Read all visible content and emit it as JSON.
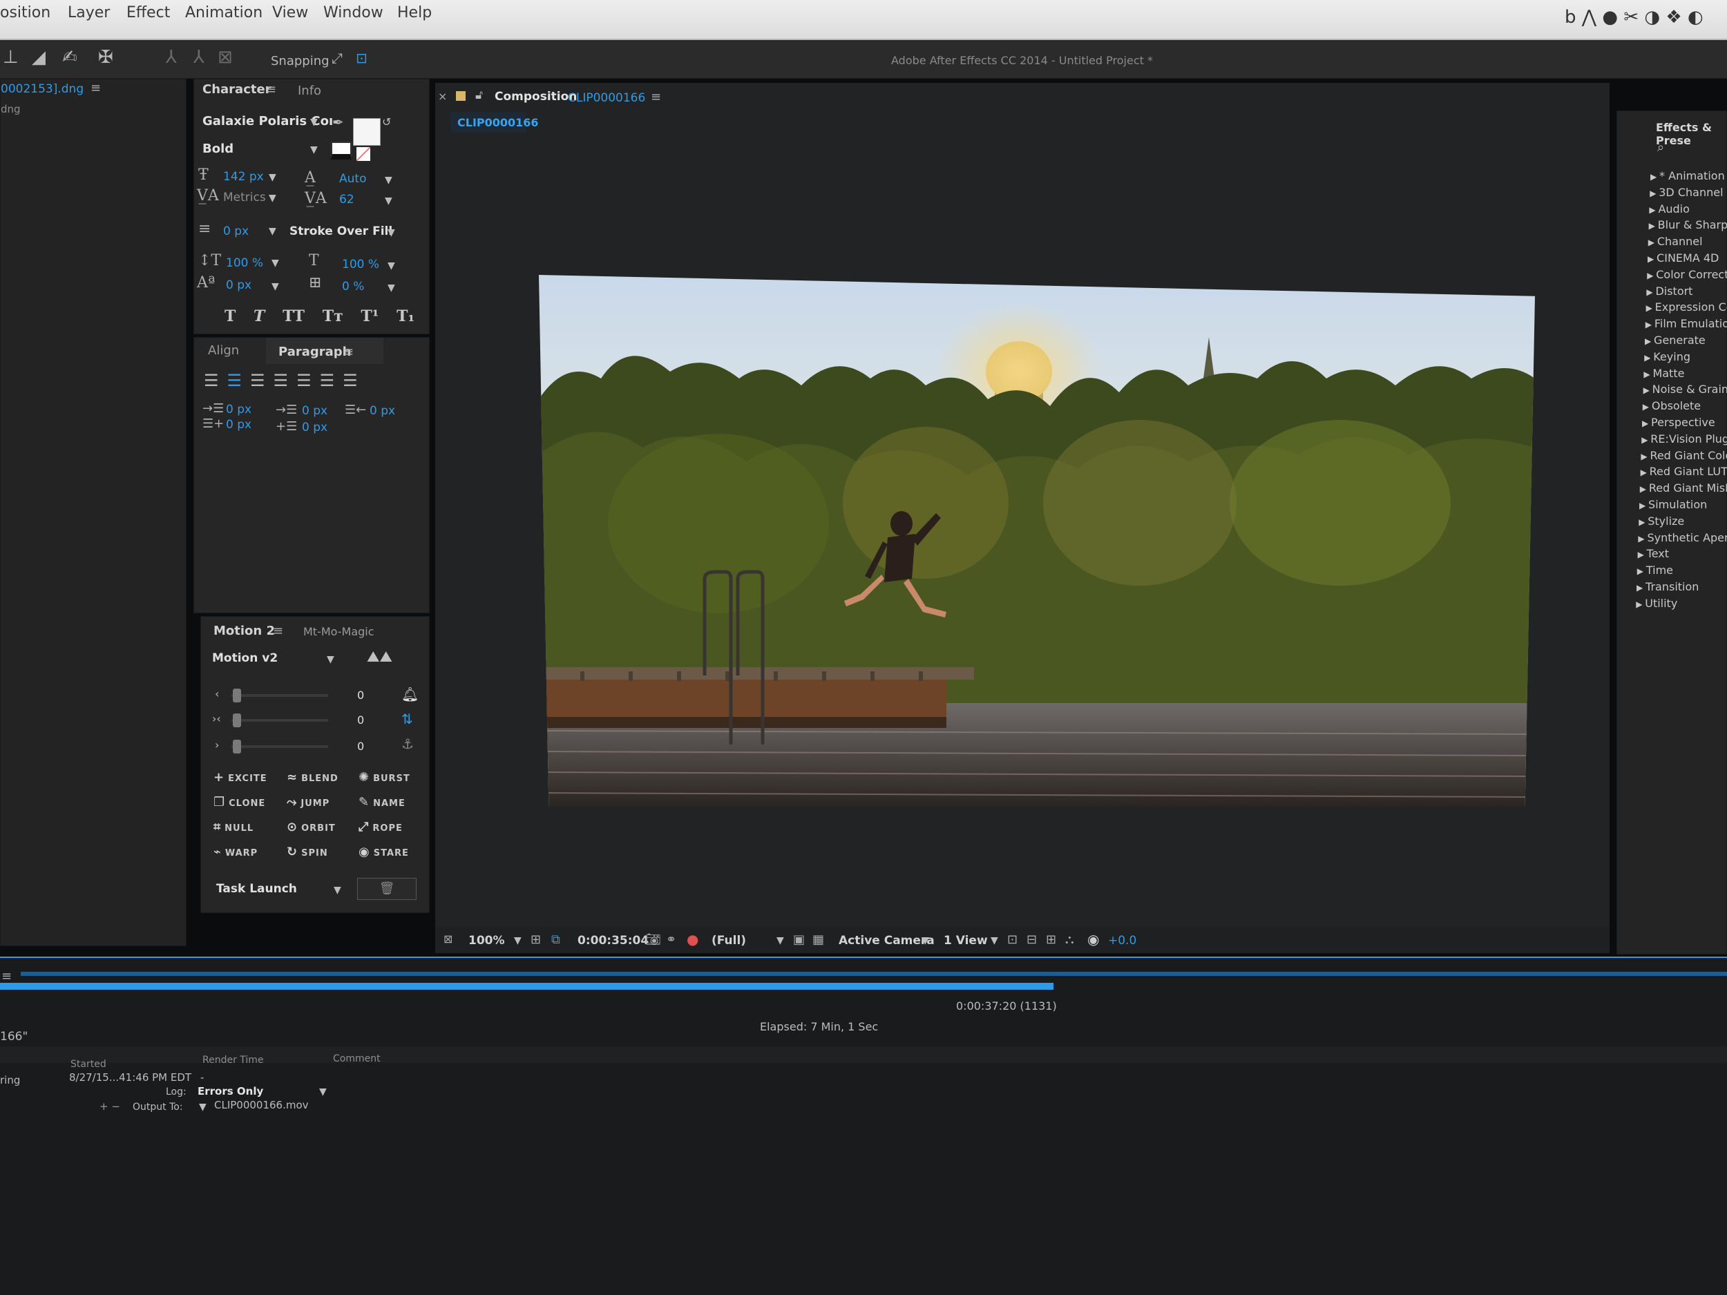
{
  "menubar": {
    "items": [
      "osition",
      "Layer",
      "Effect",
      "Animation",
      "View",
      "Window",
      "Help"
    ]
  },
  "toolbar": {
    "snapping_label": "Snapping",
    "app_title": "Adobe After Effects CC 2014 - Untitled Project *"
  },
  "project_panel": {
    "file_name": "0002153].dng",
    "file_ext": "dng"
  },
  "character": {
    "tab": "Character",
    "info_tab": "Info",
    "font_family": "Galaxie Polaris Coı",
    "font_style": "Bold",
    "font_size": "142 px",
    "leading": "Auto",
    "kerning": "Metrics",
    "tracking": "62",
    "stroke_width": "0 px",
    "stroke_mode": "Stroke Over Fill",
    "vertical_scale": "100 %",
    "horizontal_scale": "100 %",
    "baseline_shift": "0 px",
    "tsume": "0 %",
    "style_buttons": [
      "T",
      "T",
      "TT",
      "Tт",
      "T¹",
      "T₁"
    ]
  },
  "paragraph": {
    "align_tab": "Align",
    "tab": "Paragraph",
    "indent_left": "0 px",
    "indent_first": "0 px",
    "indent_right": "0 px",
    "space_before": "0 px",
    "space_after": "0 px"
  },
  "motion": {
    "tab": "Motion 2",
    "other_tab": "Mt-Mo-Magic",
    "preset": "Motion v2",
    "slider_values": [
      "0",
      "0",
      "0"
    ],
    "buttons": [
      {
        "icon": "+",
        "label": "EXCITE"
      },
      {
        "icon": "≈",
        "label": "BLEND"
      },
      {
        "icon": "✺",
        "label": "BURST"
      },
      {
        "icon": "❐",
        "label": "CLONE"
      },
      {
        "icon": "⤳",
        "label": "JUMP"
      },
      {
        "icon": "✎",
        "label": "NAME"
      },
      {
        "icon": "⌗",
        "label": "NULL"
      },
      {
        "icon": "⊙",
        "label": "ORBIT"
      },
      {
        "icon": "⤢",
        "label": "ROPE"
      },
      {
        "icon": "⌁",
        "label": "WARP"
      },
      {
        "icon": "↻",
        "label": "SPIN"
      },
      {
        "icon": "◉",
        "label": "STARE"
      }
    ],
    "task_label": "Task Launch"
  },
  "composition": {
    "panel_label": "Composition",
    "comp_name": "CLIP0000166",
    "tab_name": "CLIP0000166",
    "zoom": "100%",
    "timecode": "0:00:35:04",
    "resolution": "(Full)",
    "camera": "Active Camera",
    "views": "1 View",
    "exposure": "+0.0"
  },
  "effects": {
    "title": "Effects & Prese",
    "items": [
      "* Animation P",
      "3D Channel",
      "Audio",
      "Blur & Sharpen",
      "Channel",
      "CINEMA 4D",
      "Color Correctio",
      "Distort",
      "Expression Con",
      "Film Emulation",
      "Generate",
      "Keying",
      "Matte",
      "Noise & Grain",
      "Obsolete",
      "Perspective",
      "RE:Vision Plug-i",
      "Red Giant Color",
      "Red Giant LUT B",
      "Red Giant MisFire",
      "Simulation",
      "Stylize",
      "Synthetic Apertur",
      "Text",
      "Time",
      "Transition",
      "Utility"
    ]
  },
  "render_queue": {
    "progress": 0.61,
    "progress_time": "0:00:37:20 (1131)",
    "elapsed": "Elapsed: 7 Min, 1 Sec",
    "item_name": "166\"",
    "col_started": "Started",
    "col_render_time": "Render Time",
    "col_comment": "Comment",
    "status": "ring",
    "started": "8/27/15...41:46 PM EDT",
    "render_time": "-",
    "log_label": "Log:",
    "log_value": "Errors Only",
    "output_label": "Output To:",
    "output_file": "CLIP0000166.mov"
  },
  "colors": {
    "accent": "#2f9be8",
    "panel_bg": "#262626",
    "menubar_bg": "#e6e6e6"
  }
}
